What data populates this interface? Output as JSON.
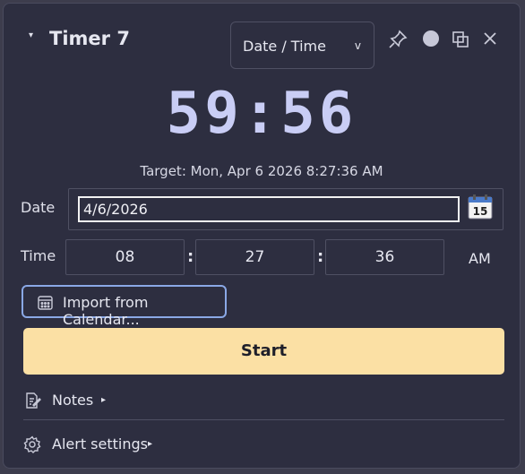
{
  "window": {
    "title": "Timer 7",
    "collapse_glyph": "▾"
  },
  "mode_select": {
    "value": "Date / Time",
    "chevron": "v"
  },
  "toolbar_icons": [
    "pin-icon",
    "status-dot-icon",
    "copy-window-icon",
    "close-icon"
  ],
  "countdown": "59:56",
  "target_text": "Target: Mon, Apr 6 2026  8:27:36 AM",
  "date": {
    "label": "Date",
    "value": "4/6/2026",
    "calendar_day": "15"
  },
  "time": {
    "label": "Time",
    "hour": "08",
    "minute": "27",
    "second": "36",
    "separator": ":",
    "ampm": "AM"
  },
  "import_button": {
    "label": "Import from Calendar..."
  },
  "start_button": {
    "label": "Start"
  },
  "notes": {
    "label": "Notes",
    "arrow": "▸"
  },
  "alert_settings": {
    "label": "Alert settings",
    "arrow": "▸"
  },
  "colors": {
    "accent": "#fbe0a4",
    "focus_border": "#8aa8e6",
    "countdown": "#c9cdf5",
    "background": "#2d2e40"
  }
}
